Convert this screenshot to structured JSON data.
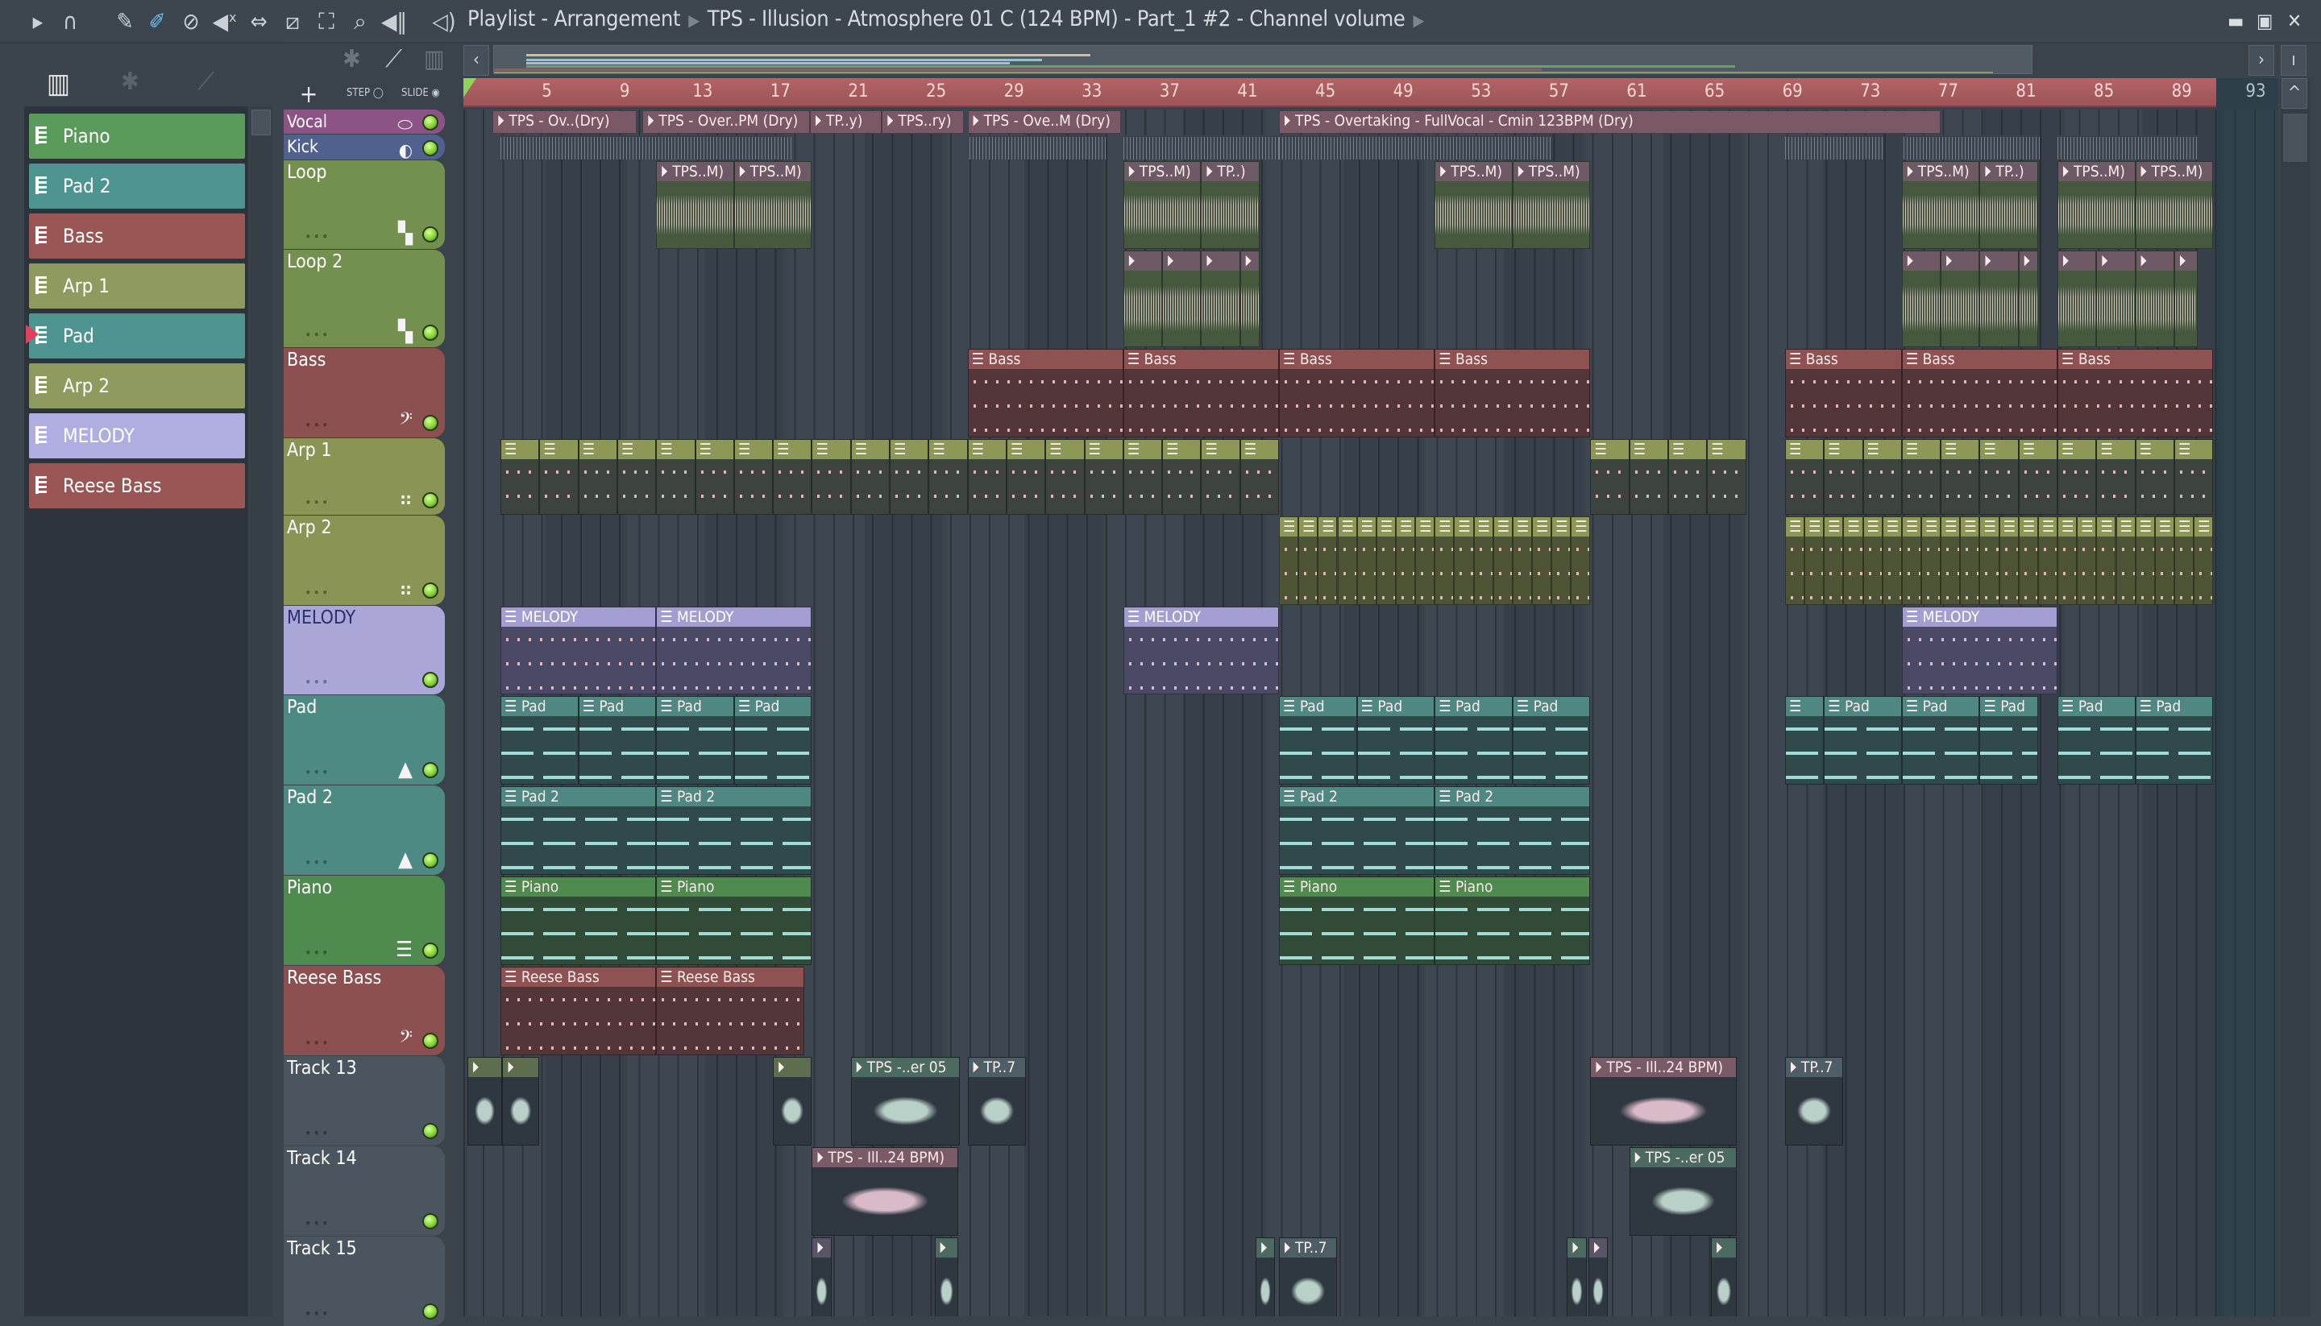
{
  "titlebar": {
    "tools": [
      "play-arrow",
      "magnet",
      "pencil",
      "paint-brush",
      "delete",
      "mute",
      "slip",
      "slice",
      "select",
      "zoom",
      "playback"
    ],
    "crumb1": "Playlist - Arrangement",
    "crumb2": "TPS - Illusion - Atmosphere 01 C (124 BPM) - Part_1 #2 - Channel volume",
    "minimize": "▬",
    "maximize": "▣",
    "close": "✕"
  },
  "toolbar2": {
    "add": "+",
    "step": "STEP",
    "slide": "SLIDE"
  },
  "picker": [
    {
      "label": "Piano",
      "color": "#5a9a5a"
    },
    {
      "label": "Pad 2",
      "color": "#4e9490"
    },
    {
      "label": "Bass",
      "color": "#9a5555"
    },
    {
      "label": "Arp 1",
      "color": "#8f9a5e"
    },
    {
      "label": "Pad",
      "color": "#4e9490",
      "selected": true
    },
    {
      "label": "Arp 2",
      "color": "#8f9a5e"
    },
    {
      "label": "MELODY",
      "color": "#b0aee0"
    },
    {
      "label": "Reese Bass",
      "color": "#9a5555"
    }
  ],
  "ruler": {
    "bars": [
      "5",
      "9",
      "13",
      "17",
      "21",
      "25",
      "29",
      "33",
      "37",
      "41",
      "45",
      "49",
      "53",
      "57",
      "61",
      "65",
      "69",
      "73",
      "77",
      "81",
      "85",
      "89",
      "93"
    ]
  },
  "tracks": [
    {
      "name": "Vocal",
      "color": "#8c5485",
      "icon": "⬭",
      "hdr": "#7a5866",
      "body": "#5c4550"
    },
    {
      "name": "Kick",
      "color": "#50608f",
      "icon": "◐",
      "hdr": "#454f5a",
      "body": "#3d4650"
    },
    {
      "name": "Loop",
      "color": "#74904f",
      "icon": "▚",
      "hdr": "#6e5a66",
      "body": "#46583e"
    },
    {
      "name": "Loop 2",
      "color": "#74904f",
      "icon": "▚",
      "hdr": "#6e5a66",
      "body": "#46583e"
    },
    {
      "name": "Bass",
      "color": "#8c5050",
      "icon": "𝄢",
      "hdr": "#8e5252",
      "body": "#523639"
    },
    {
      "name": "Arp 1",
      "color": "#8a9455",
      "icon": "⠶",
      "hdr": "#8d9856",
      "body": "#3d4440"
    },
    {
      "name": "Arp 2",
      "color": "#8a9455",
      "icon": "⠶",
      "hdr": "#8d9856",
      "body": "#4e5436"
    },
    {
      "name": "MELODY",
      "color": "#aaa6d8",
      "icon": "",
      "hdr": "#a39ed2",
      "body": "#4b4a66",
      "dark": true
    },
    {
      "name": "Pad",
      "color": "#4e8a84",
      "icon": "▲",
      "hdr": "#4f8882",
      "body": "#30494b"
    },
    {
      "name": "Pad 2",
      "color": "#4e8a84",
      "icon": "▲",
      "hdr": "#4f8882",
      "body": "#30494b"
    },
    {
      "name": "Piano",
      "color": "#4f8a4f",
      "icon": "☰",
      "hdr": "#4f8a4f",
      "body": "#324a38"
    },
    {
      "name": "Reese Bass",
      "color": "#8c5050",
      "icon": "𝄢",
      "hdr": "#8e5252",
      "body": "#523639"
    },
    {
      "name": "Track 13",
      "color": "#4a5560",
      "icon": "",
      "hdr": "#4e6066",
      "body": "#333c45"
    },
    {
      "name": "Track 14",
      "color": "#4a5560",
      "icon": "",
      "hdr": "#4e6066",
      "body": "#333c45"
    },
    {
      "name": "Track 15",
      "color": "#4a5560",
      "icon": "",
      "hdr": "#4e6066",
      "body": "#333c45"
    }
  ],
  "clips": [
    {
      "t": 0,
      "s": 2.3,
      "l": 7.4,
      "label": "TPS - Ov..(Dry)"
    },
    {
      "t": 0,
      "s": 10,
      "l": 8.6,
      "label": "TPS - Over..PM (Dry)"
    },
    {
      "t": 0,
      "s": 18.6,
      "l": 3.7,
      "label": "TP..y)"
    },
    {
      "t": 0,
      "s": 22.3,
      "l": 4.2,
      "label": "TPS..ry)"
    },
    {
      "t": 0,
      "s": 26.7,
      "l": 7.9,
      "label": "TPS - Ove..M (Dry)"
    },
    {
      "t": 0,
      "s": 42.7,
      "l": 34,
      "label": "TPS - Overtaking - FullVocal - Cmin 123BPM (Dry)"
    },
    {
      "t": 1,
      "s": 2.7,
      "l": 15,
      "label": ""
    },
    {
      "t": 1,
      "s": 26.8,
      "l": 7,
      "label": ""
    },
    {
      "t": 1,
      "s": 34.7,
      "l": 8,
      "label": ""
    },
    {
      "t": 1,
      "s": 42.7,
      "l": 14,
      "label": ""
    },
    {
      "t": 1,
      "s": 68.7,
      "l": 5,
      "label": ""
    },
    {
      "t": 1,
      "s": 74.8,
      "l": 7,
      "label": ""
    },
    {
      "t": 1,
      "s": 82.7,
      "l": 7.2,
      "label": ""
    },
    {
      "t": 2,
      "s": 10.7,
      "l": 4,
      "label": "TPS..M)"
    },
    {
      "t": 2,
      "s": 14.7,
      "l": 4,
      "label": "TPS..M)"
    },
    {
      "t": 2,
      "s": 34.7,
      "l": 4,
      "label": "TPS..M)"
    },
    {
      "t": 2,
      "s": 38.7,
      "l": 3,
      "label": "TP..)"
    },
    {
      "t": 2,
      "s": 50.7,
      "l": 4,
      "label": "TPS..M)"
    },
    {
      "t": 2,
      "s": 54.7,
      "l": 4,
      "label": "TPS..M)"
    },
    {
      "t": 2,
      "s": 74.7,
      "l": 4,
      "label": "TPS..M)"
    },
    {
      "t": 2,
      "s": 78.7,
      "l": 3,
      "label": "TP..)"
    },
    {
      "t": 2,
      "s": 82.7,
      "l": 4,
      "label": "TPS..M)"
    },
    {
      "t": 2,
      "s": 86.7,
      "l": 4,
      "label": "TPS..M)"
    },
    {
      "t": 3,
      "s": 34.7,
      "l": 2,
      "label": ""
    },
    {
      "t": 3,
      "s": 36.7,
      "l": 2,
      "label": ""
    },
    {
      "t": 3,
      "s": 38.7,
      "l": 2,
      "label": ""
    },
    {
      "t": 3,
      "s": 40.7,
      "l": 1,
      "label": ""
    },
    {
      "t": 3,
      "s": 74.7,
      "l": 2,
      "label": ""
    },
    {
      "t": 3,
      "s": 76.7,
      "l": 2,
      "label": ""
    },
    {
      "t": 3,
      "s": 78.7,
      "l": 2,
      "label": ""
    },
    {
      "t": 3,
      "s": 80.7,
      "l": 1,
      "label": ""
    },
    {
      "t": 3,
      "s": 82.7,
      "l": 2,
      "label": ""
    },
    {
      "t": 3,
      "s": 84.7,
      "l": 2,
      "label": ""
    },
    {
      "t": 3,
      "s": 86.7,
      "l": 2,
      "label": ""
    },
    {
      "t": 3,
      "s": 88.7,
      "l": 1.2,
      "label": ""
    },
    {
      "t": 4,
      "s": 26.7,
      "l": 8,
      "label": "Bass"
    },
    {
      "t": 4,
      "s": 34.7,
      "l": 8,
      "label": "Bass"
    },
    {
      "t": 4,
      "s": 42.7,
      "l": 8,
      "label": "Bass"
    },
    {
      "t": 4,
      "s": 50.7,
      "l": 8,
      "label": "Bass"
    },
    {
      "t": 4,
      "s": 68.7,
      "l": 6,
      "label": "Bass"
    },
    {
      "t": 4,
      "s": 74.7,
      "l": 8,
      "label": "Bass"
    },
    {
      "t": 4,
      "s": 82.7,
      "l": 8,
      "label": "Bass"
    },
    {
      "t": 7,
      "s": 2.7,
      "l": 8,
      "label": "MELODY"
    },
    {
      "t": 7,
      "s": 10.7,
      "l": 8,
      "label": "MELODY"
    },
    {
      "t": 7,
      "s": 34.7,
      "l": 8,
      "label": "MELODY"
    },
    {
      "t": 7,
      "s": 74.7,
      "l": 8,
      "label": "MELODY"
    },
    {
      "t": 8,
      "s": 2.7,
      "l": 4,
      "label": "Pad"
    },
    {
      "t": 8,
      "s": 6.7,
      "l": 4,
      "label": "Pad"
    },
    {
      "t": 8,
      "s": 10.7,
      "l": 4,
      "label": "Pad"
    },
    {
      "t": 8,
      "s": 14.7,
      "l": 4,
      "label": "Pad"
    },
    {
      "t": 8,
      "s": 42.7,
      "l": 4,
      "label": "Pad"
    },
    {
      "t": 8,
      "s": 46.7,
      "l": 4,
      "label": "Pad"
    },
    {
      "t": 8,
      "s": 50.7,
      "l": 4,
      "label": "Pad"
    },
    {
      "t": 8,
      "s": 54.7,
      "l": 4,
      "label": "Pad"
    },
    {
      "t": 8,
      "s": 68.7,
      "l": 2,
      "label": ""
    },
    {
      "t": 8,
      "s": 70.7,
      "l": 4,
      "label": "Pad"
    },
    {
      "t": 8,
      "s": 74.7,
      "l": 4,
      "label": "Pad"
    },
    {
      "t": 8,
      "s": 78.7,
      "l": 3,
      "label": "Pad"
    },
    {
      "t": 8,
      "s": 82.7,
      "l": 4,
      "label": "Pad"
    },
    {
      "t": 8,
      "s": 86.7,
      "l": 4,
      "label": "Pad"
    },
    {
      "t": 9,
      "s": 2.7,
      "l": 8,
      "label": "Pad 2"
    },
    {
      "t": 9,
      "s": 10.7,
      "l": 8,
      "label": "Pad 2"
    },
    {
      "t": 9,
      "s": 42.7,
      "l": 8,
      "label": "Pad 2"
    },
    {
      "t": 9,
      "s": 50.7,
      "l": 8,
      "label": "Pad 2"
    },
    {
      "t": 10,
      "s": 2.7,
      "l": 8,
      "label": "Piano"
    },
    {
      "t": 10,
      "s": 10.7,
      "l": 8,
      "label": "Piano"
    },
    {
      "t": 10,
      "s": 42.7,
      "l": 8,
      "label": "Piano"
    },
    {
      "t": 10,
      "s": 50.7,
      "l": 8,
      "label": "Piano"
    },
    {
      "t": 11,
      "s": 2.7,
      "l": 8,
      "label": "Reese Bass"
    },
    {
      "t": 11,
      "s": 10.7,
      "l": 7.6,
      "label": "Reese Bass"
    },
    {
      "t": 12,
      "s": 1,
      "l": 1.8,
      "label": "",
      "c": "#5c6e4e"
    },
    {
      "t": 12,
      "s": 2.8,
      "l": 1.9,
      "label": "",
      "c": "#5c6e4e"
    },
    {
      "t": 12,
      "s": 16.7,
      "l": 2,
      "label": "",
      "c": "#5c6e4e"
    },
    {
      "t": 12,
      "s": 20.7,
      "l": 5.6,
      "label": "TPS -..er 05",
      "c": "#4b6a60"
    },
    {
      "t": 12,
      "s": 26.7,
      "l": 3,
      "label": "TP..7",
      "c": "#4e5e66"
    },
    {
      "t": 12,
      "s": 58.7,
      "l": 7.5,
      "label": "TPS - Ill..24 BPM)",
      "c": "#7a5a66"
    },
    {
      "t": 12,
      "s": 68.7,
      "l": 3,
      "label": "TP..7",
      "c": "#4e5e66"
    },
    {
      "t": 13,
      "s": 18.7,
      "l": 7.5,
      "label": "TPS - Ill..24 BPM)",
      "c": "#7a5a66"
    },
    {
      "t": 13,
      "s": 60.7,
      "l": 5.5,
      "label": "TPS -..er 05",
      "c": "#4b6a60"
    },
    {
      "t": 14,
      "s": 18.7,
      "l": 1,
      "label": "",
      "c": "#5a5468"
    },
    {
      "t": 14,
      "s": 25,
      "l": 1.2,
      "label": "",
      "c": "#4b6a60"
    },
    {
      "t": 14,
      "s": 41.5,
      "l": 1,
      "label": "",
      "c": "#4b6a60"
    },
    {
      "t": 14,
      "s": 42.7,
      "l": 3,
      "label": "TP..7",
      "c": "#4e5e66"
    },
    {
      "t": 14,
      "s": 57.5,
      "l": 1,
      "label": "",
      "c": "#4b6a60"
    },
    {
      "t": 14,
      "s": 58.6,
      "l": 1,
      "label": "",
      "c": "#5a5468"
    },
    {
      "t": 14,
      "s": 64.9,
      "l": 1.3,
      "label": "",
      "c": "#4b6a60"
    }
  ],
  "pattern_runs": [
    {
      "t": 5,
      "s": 2.7,
      "n": 12,
      "l": 2
    },
    {
      "t": 5,
      "s": 26.7,
      "n": 8,
      "l": 2
    },
    {
      "t": 5,
      "s": 58.7,
      "n": 4,
      "l": 2
    },
    {
      "t": 5,
      "s": 68.7,
      "n": 11,
      "l": 2
    },
    {
      "t": 6,
      "s": 42.7,
      "n": 16,
      "l": 1
    },
    {
      "t": 6,
      "s": 68.7,
      "n": 22,
      "l": 1
    }
  ]
}
